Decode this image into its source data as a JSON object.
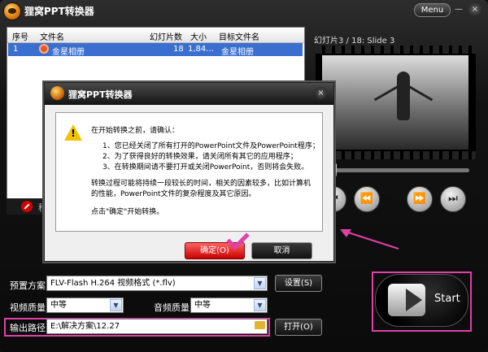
{
  "window": {
    "title": "狸窝PPT转换器",
    "menu_label": "Menu",
    "min_glyph": "—",
    "close_glyph": "×"
  },
  "table": {
    "headers": [
      "序号",
      "文件名",
      "幻灯片数",
      "大小",
      "目标文件名"
    ],
    "rows": [
      {
        "index": "1",
        "filename": "金星相册",
        "slides": "18",
        "size": "1,84...",
        "target": "金星相册"
      }
    ]
  },
  "bottom_bar": {
    "delete_label": "移"
  },
  "preview": {
    "title": "幻灯片3 / 18: Slide 3",
    "progress": 0.05,
    "buttons": [
      "⏮",
      "⏪",
      "⏩",
      "⏭"
    ]
  },
  "dialog": {
    "title": "狸窝PPT转换器",
    "close_glyph": "×",
    "warn_mark": "!",
    "lines": [
      "在开始转换之前，请确认：",
      "1、您已经关闭了所有打开的PowerPoint文件及PowerPoint程序；",
      "2、为了获得良好的转换效果，请关闭所有其它的应用程序；",
      "3、在转换期间请不要打开或关闭PowerPoint，否则将会失败。",
      "转换过程可能将持续一段较长的时间，相关的因素较多，比如计算机",
      "的性能，PowerPoint文件的复杂程度及其它原因。",
      "点击\"确定\"开始转换。"
    ],
    "ok_label": "确定(O)",
    "cancel_label": "取消"
  },
  "settings": {
    "preset_label": "预置方案:",
    "preset_value": "FLV-Flash H.264 视频格式 (*.flv)",
    "settings_button": "设置(S)",
    "video_quality_label": "视频质量:",
    "video_quality_value": "中等",
    "audio_quality_label": "音频质量:",
    "audio_quality_value": "中等",
    "output_label": "输出路径:",
    "output_value": "E:\\解决方案\\12.27",
    "open_button": "打开(O)",
    "start_label": "Start"
  },
  "colors": {
    "highlight": "#e040a8",
    "selection": "#3a6fd0",
    "ok_button": "#c80000"
  }
}
